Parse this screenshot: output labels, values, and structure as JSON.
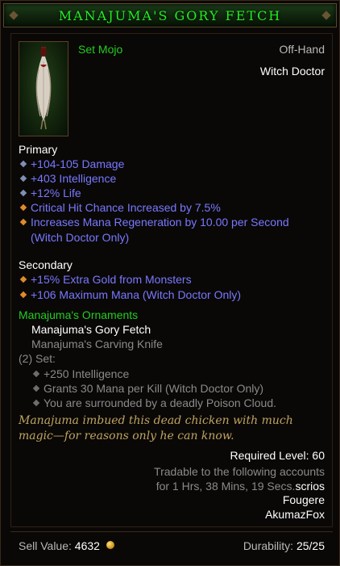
{
  "item": {
    "name": "Manajuma's Gory Fetch",
    "type": "Set Mojo",
    "slot": "Off-Hand",
    "class": "Witch Doctor"
  },
  "primary": {
    "label": "Primary",
    "stats": [
      {
        "text": "+104-105 Damage",
        "color": "blue"
      },
      {
        "text": "+403 Intelligence",
        "color": "blue"
      },
      {
        "text": "+12% Life",
        "color": "blue"
      },
      {
        "text": "Critical Hit Chance Increased by 7.5%",
        "color": "blue"
      },
      {
        "text": "Increases Mana Regeneration by 10.00 per Second",
        "text2": "(Witch Doctor Only)",
        "color": "blue"
      }
    ]
  },
  "secondary": {
    "label": "Secondary",
    "stats": [
      {
        "text": "+15% Extra Gold from Monsters"
      },
      {
        "text": "+106 Maximum Mana (Witch Doctor Only)"
      }
    ]
  },
  "set": {
    "name": "Manajuma's Ornaments",
    "items": [
      "Manajuma's Gory Fetch",
      "Manajuma's Carving Knife"
    ],
    "bonus_label": "(2) Set:",
    "bonuses": [
      "+250 Intelligence",
      "Grants 30 Mana per Kill (Witch Doctor Only)",
      "You are surrounded by a deadly Poison Cloud."
    ]
  },
  "flavor": "Manajuma imbued this dead chicken with much magic—for reasons only he can know.",
  "required_level": "Required Level: 60",
  "trade": {
    "line1": "Tradable to the following accounts",
    "line2": "for 1 Hrs, 38 Mins, 19 Secs.",
    "accounts": [
      "scrios",
      "Fougere",
      "AkumazFox"
    ]
  },
  "footer": {
    "sell_label": "Sell Value: ",
    "sell_value": "4632",
    "durability_label": "Durability: ",
    "durability_value": "25/25"
  },
  "colors": {
    "set_green": "#22cc22",
    "magic_blue": "#7878ff",
    "flavor_gold": "#bfa462"
  }
}
